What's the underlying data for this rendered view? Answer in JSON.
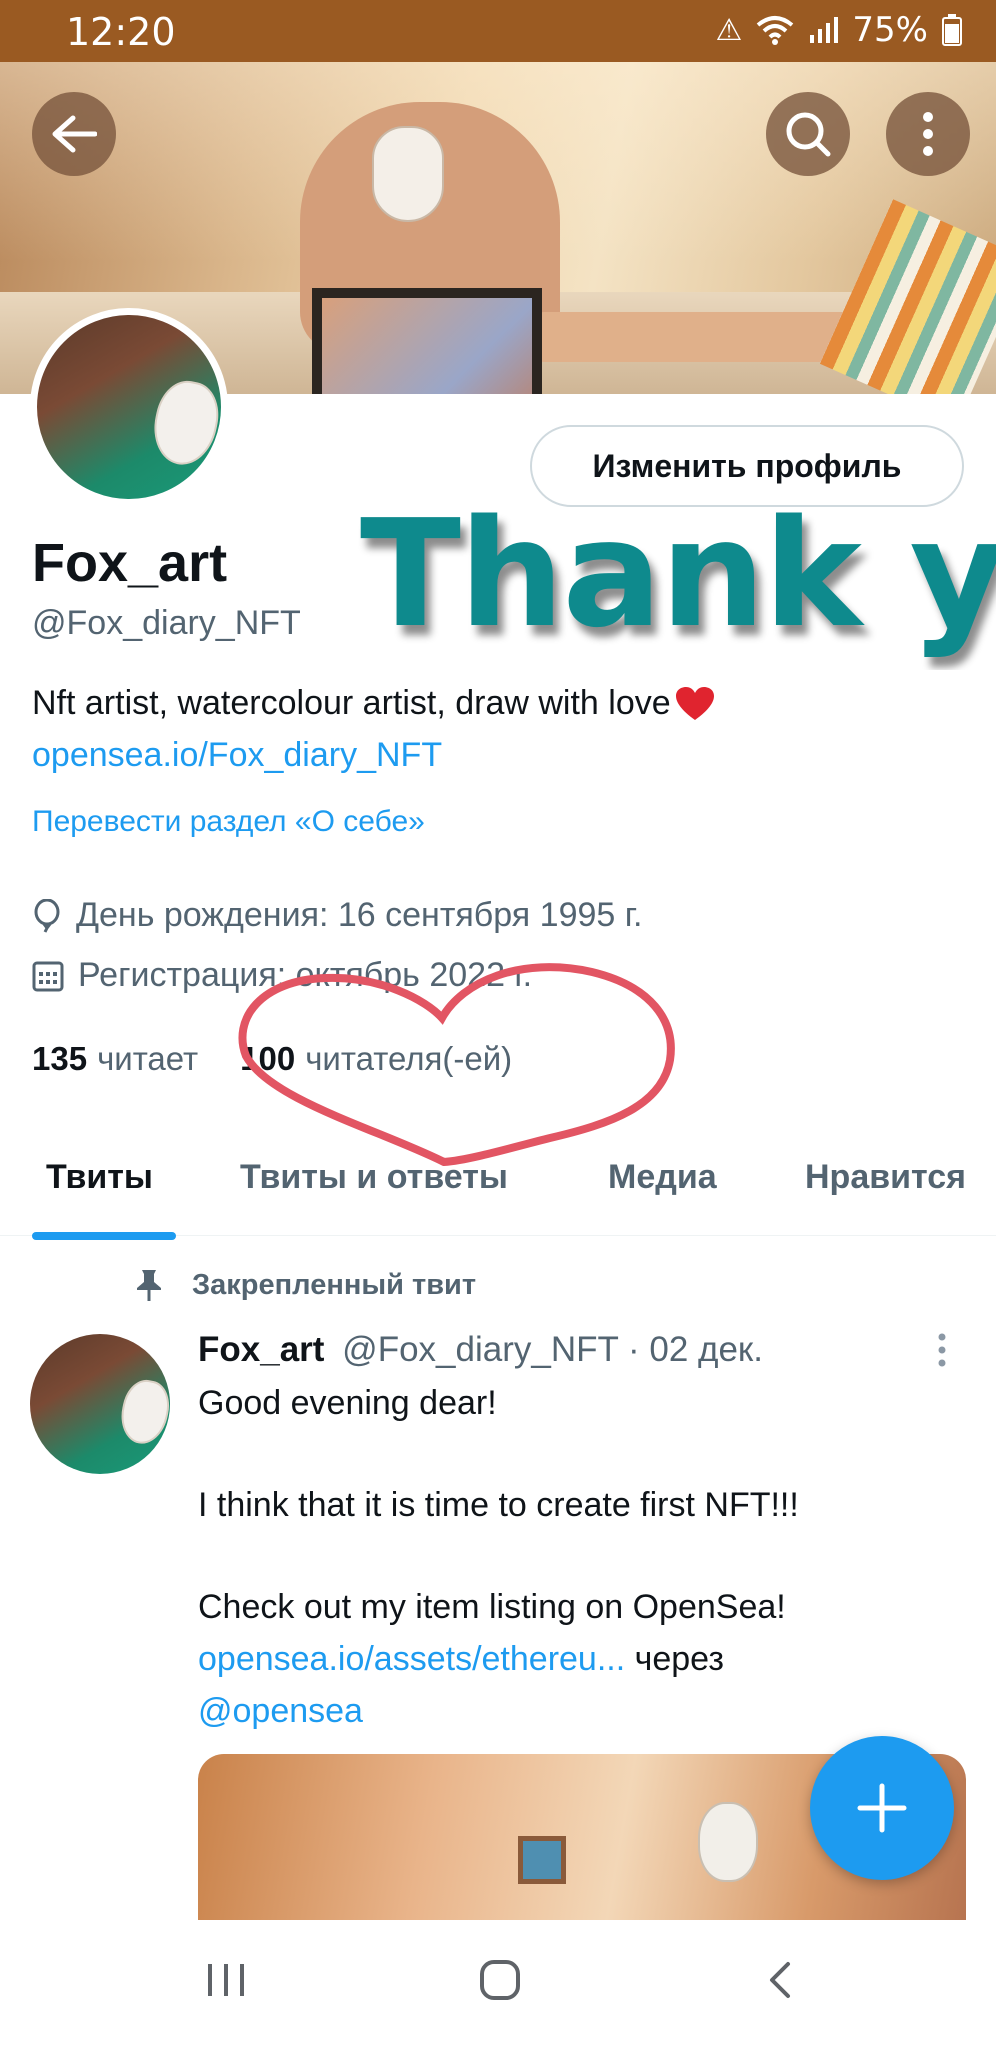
{
  "status_bar": {
    "time": "12:20",
    "battery": "75%",
    "icons": [
      "alert-icon",
      "wifi-icon",
      "signal-icon",
      "battery-icon"
    ]
  },
  "header": {
    "back_icon": "back-arrow-icon",
    "search_icon": "search-icon",
    "more_icon": "more-vertical-icon"
  },
  "profile": {
    "edit_button": "Изменить профиль",
    "display_name": "Fox_art",
    "handle": "@Fox_diary_NFT",
    "bio": "Nft artist, watercolour artist, draw with love",
    "link": "opensea.io/Fox_diary_NFT",
    "translate": "Перевести раздел «О себе»",
    "birthday": "День рождения: 16 сентября 1995 г.",
    "joined": "Регистрация: октябрь 2022 г.",
    "following_count": "135",
    "following_label": "читает",
    "followers_count": "100",
    "followers_label": "читателя(-ей)"
  },
  "overlay": {
    "text": "Thank you",
    "color": "#0e8a8d",
    "heart_color": "#e25563"
  },
  "tabs": [
    {
      "label": "Твиты",
      "active": true
    },
    {
      "label": "Твиты и ответы",
      "active": false
    },
    {
      "label": "Медиа",
      "active": false
    },
    {
      "label": "Нравится",
      "active": false
    }
  ],
  "pinned_tweet": {
    "pinned_label": "Закрепленный твит",
    "author_name": "Fox_art",
    "author_handle": "@Fox_diary_NFT",
    "separator": "·",
    "date": "02 дек.",
    "line1": "Good evening dear!",
    "line2": "I think that it is time to create first NFT!!!",
    "line3": "Check out my item listing on OpenSea!",
    "link": "opensea.io/assets/ethereu...",
    "via": "через",
    "mention": "@opensea"
  },
  "fab": {
    "icon": "plus-icon"
  },
  "nav_bar": {
    "icons": [
      "recent-apps-icon",
      "home-icon",
      "back-icon"
    ]
  },
  "colors": {
    "accent": "#1d9bf0",
    "status_bar": "#9a5a22",
    "text_primary": "#0f1419",
    "text_secondary": "#536471"
  }
}
